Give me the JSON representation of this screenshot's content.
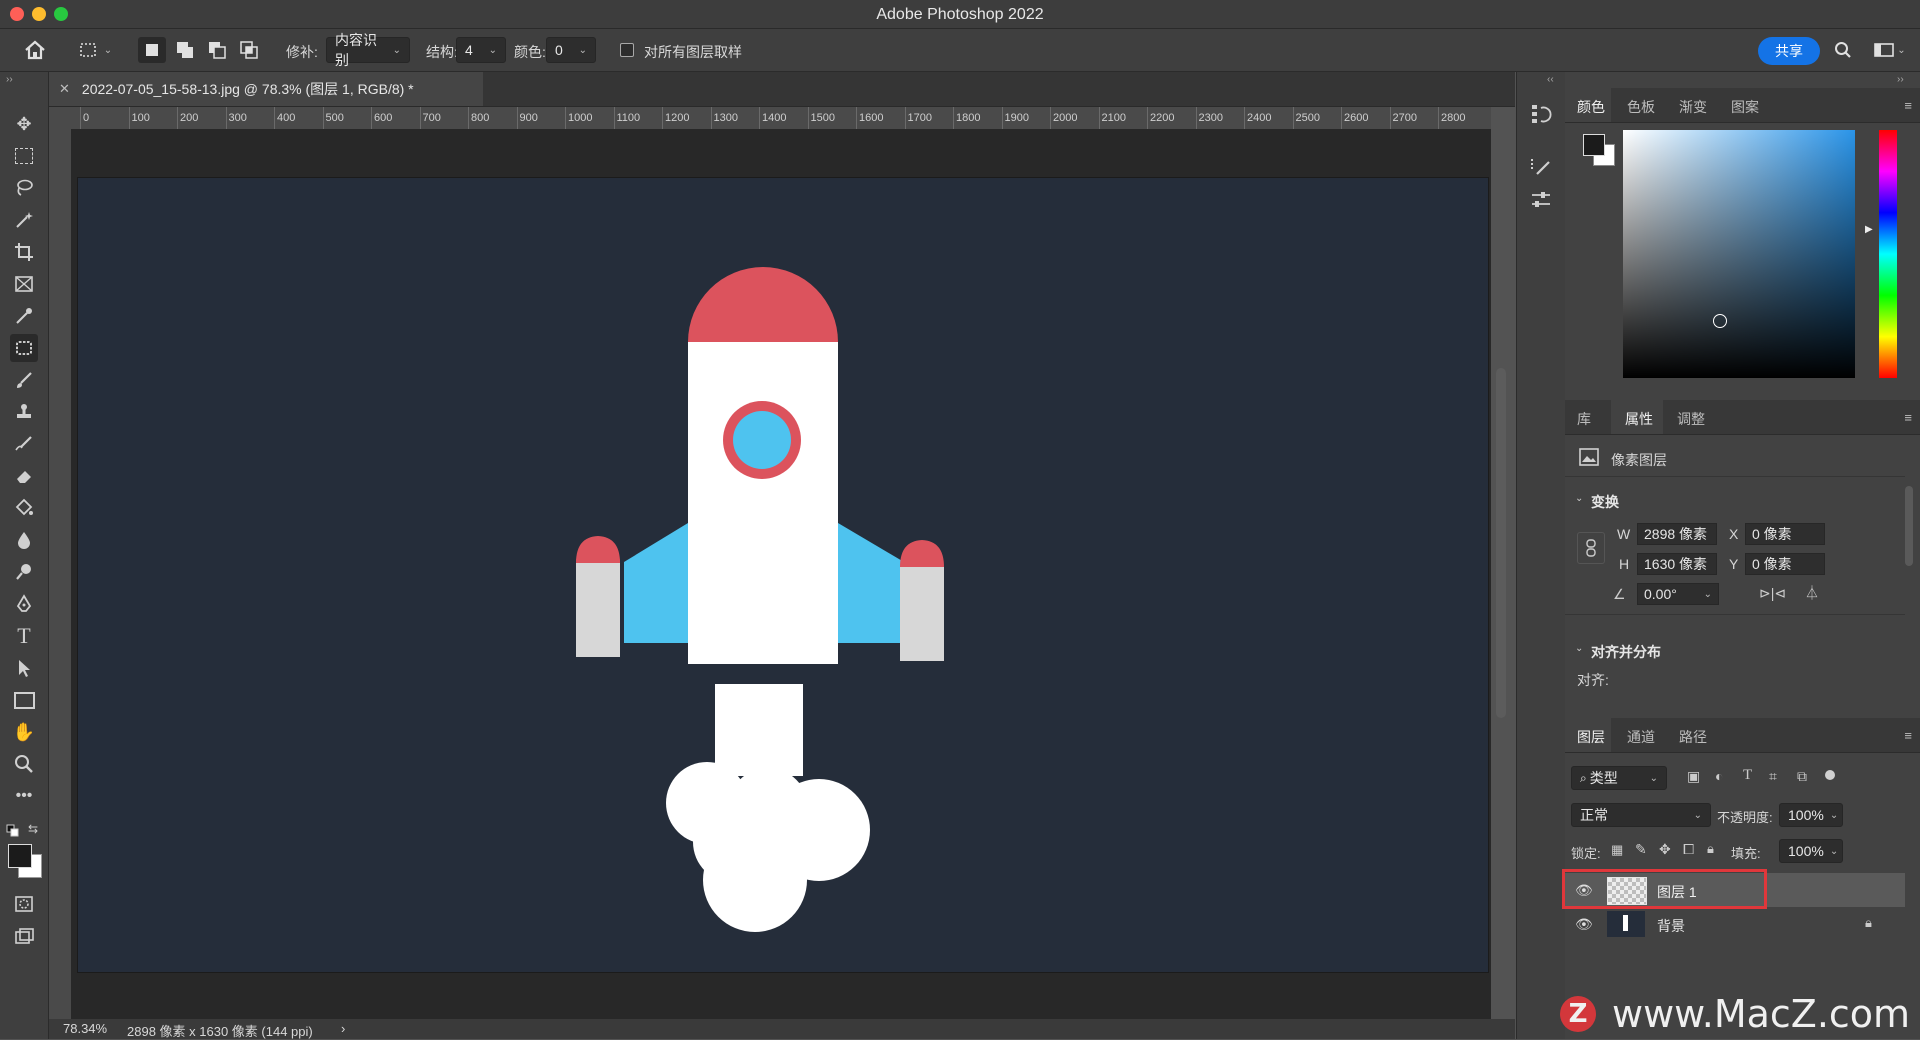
{
  "window": {
    "title": "Adobe Photoshop 2022"
  },
  "options_bar": {
    "patch_label": "修补:",
    "patch_value": "内容识别",
    "structure_label": "结构:",
    "structure_value": "4",
    "color_label": "颜色:",
    "color_value": "0",
    "sample_all_layers": "对所有图层取样",
    "share": "共享"
  },
  "document": {
    "tab_title": "2022-07-05_15-58-13.jpg @ 78.3% (图层 1, RGB/8) *"
  },
  "ruler": {
    "ticks": [
      "0",
      "100",
      "200",
      "300",
      "400",
      "500",
      "600",
      "700",
      "800",
      "900",
      "1000",
      "1100",
      "1200",
      "1300",
      "1400",
      "1500",
      "1600",
      "1700",
      "1800",
      "1900",
      "2000",
      "2100",
      "2200",
      "2300",
      "2400",
      "2500",
      "2600",
      "2700",
      "2800"
    ]
  },
  "status": {
    "zoom": "78.34%",
    "info": "2898 像素 x 1630 像素 (144 ppi)",
    "arrow": "›"
  },
  "color_panel": {
    "tabs": [
      "颜色",
      "色板",
      "渐变",
      "图案"
    ]
  },
  "properties_panel": {
    "tabs": [
      "库",
      "属性",
      "调整"
    ],
    "layer_type": "像素图层",
    "transform_title": "变换",
    "w_label": "W",
    "w_value": "2898 像素",
    "h_label": "H",
    "h_value": "1630 像素",
    "x_label": "X",
    "x_value": "0 像素",
    "y_label": "Y",
    "y_value": "0 像素",
    "angle_value": "0.00°",
    "align_title": "对齐并分布",
    "align_label": "对齐:"
  },
  "layers_panel": {
    "tabs": [
      "图层",
      "通道",
      "路径"
    ],
    "filter_label": "类型",
    "blend_mode": "正常",
    "opacity_label": "不透明度:",
    "opacity_value": "100%",
    "lock_label": "锁定:",
    "fill_label": "填充:",
    "fill_value": "100%",
    "layers": [
      {
        "name": "图层 1",
        "selected": true
      },
      {
        "name": "背景",
        "selected": false
      }
    ]
  },
  "watermark": {
    "text": "www.MacZ.com",
    "logo_letter": "Z"
  },
  "colors": {
    "canvas_bg": "#252d3a",
    "rocket_red": "#dc535d",
    "rocket_blue": "#4ec3ef",
    "rocket_white": "#ffffff",
    "rocket_gray": "#d7d7d7",
    "accent_blue": "#1473e6",
    "highlight_red": "#e0373b"
  }
}
